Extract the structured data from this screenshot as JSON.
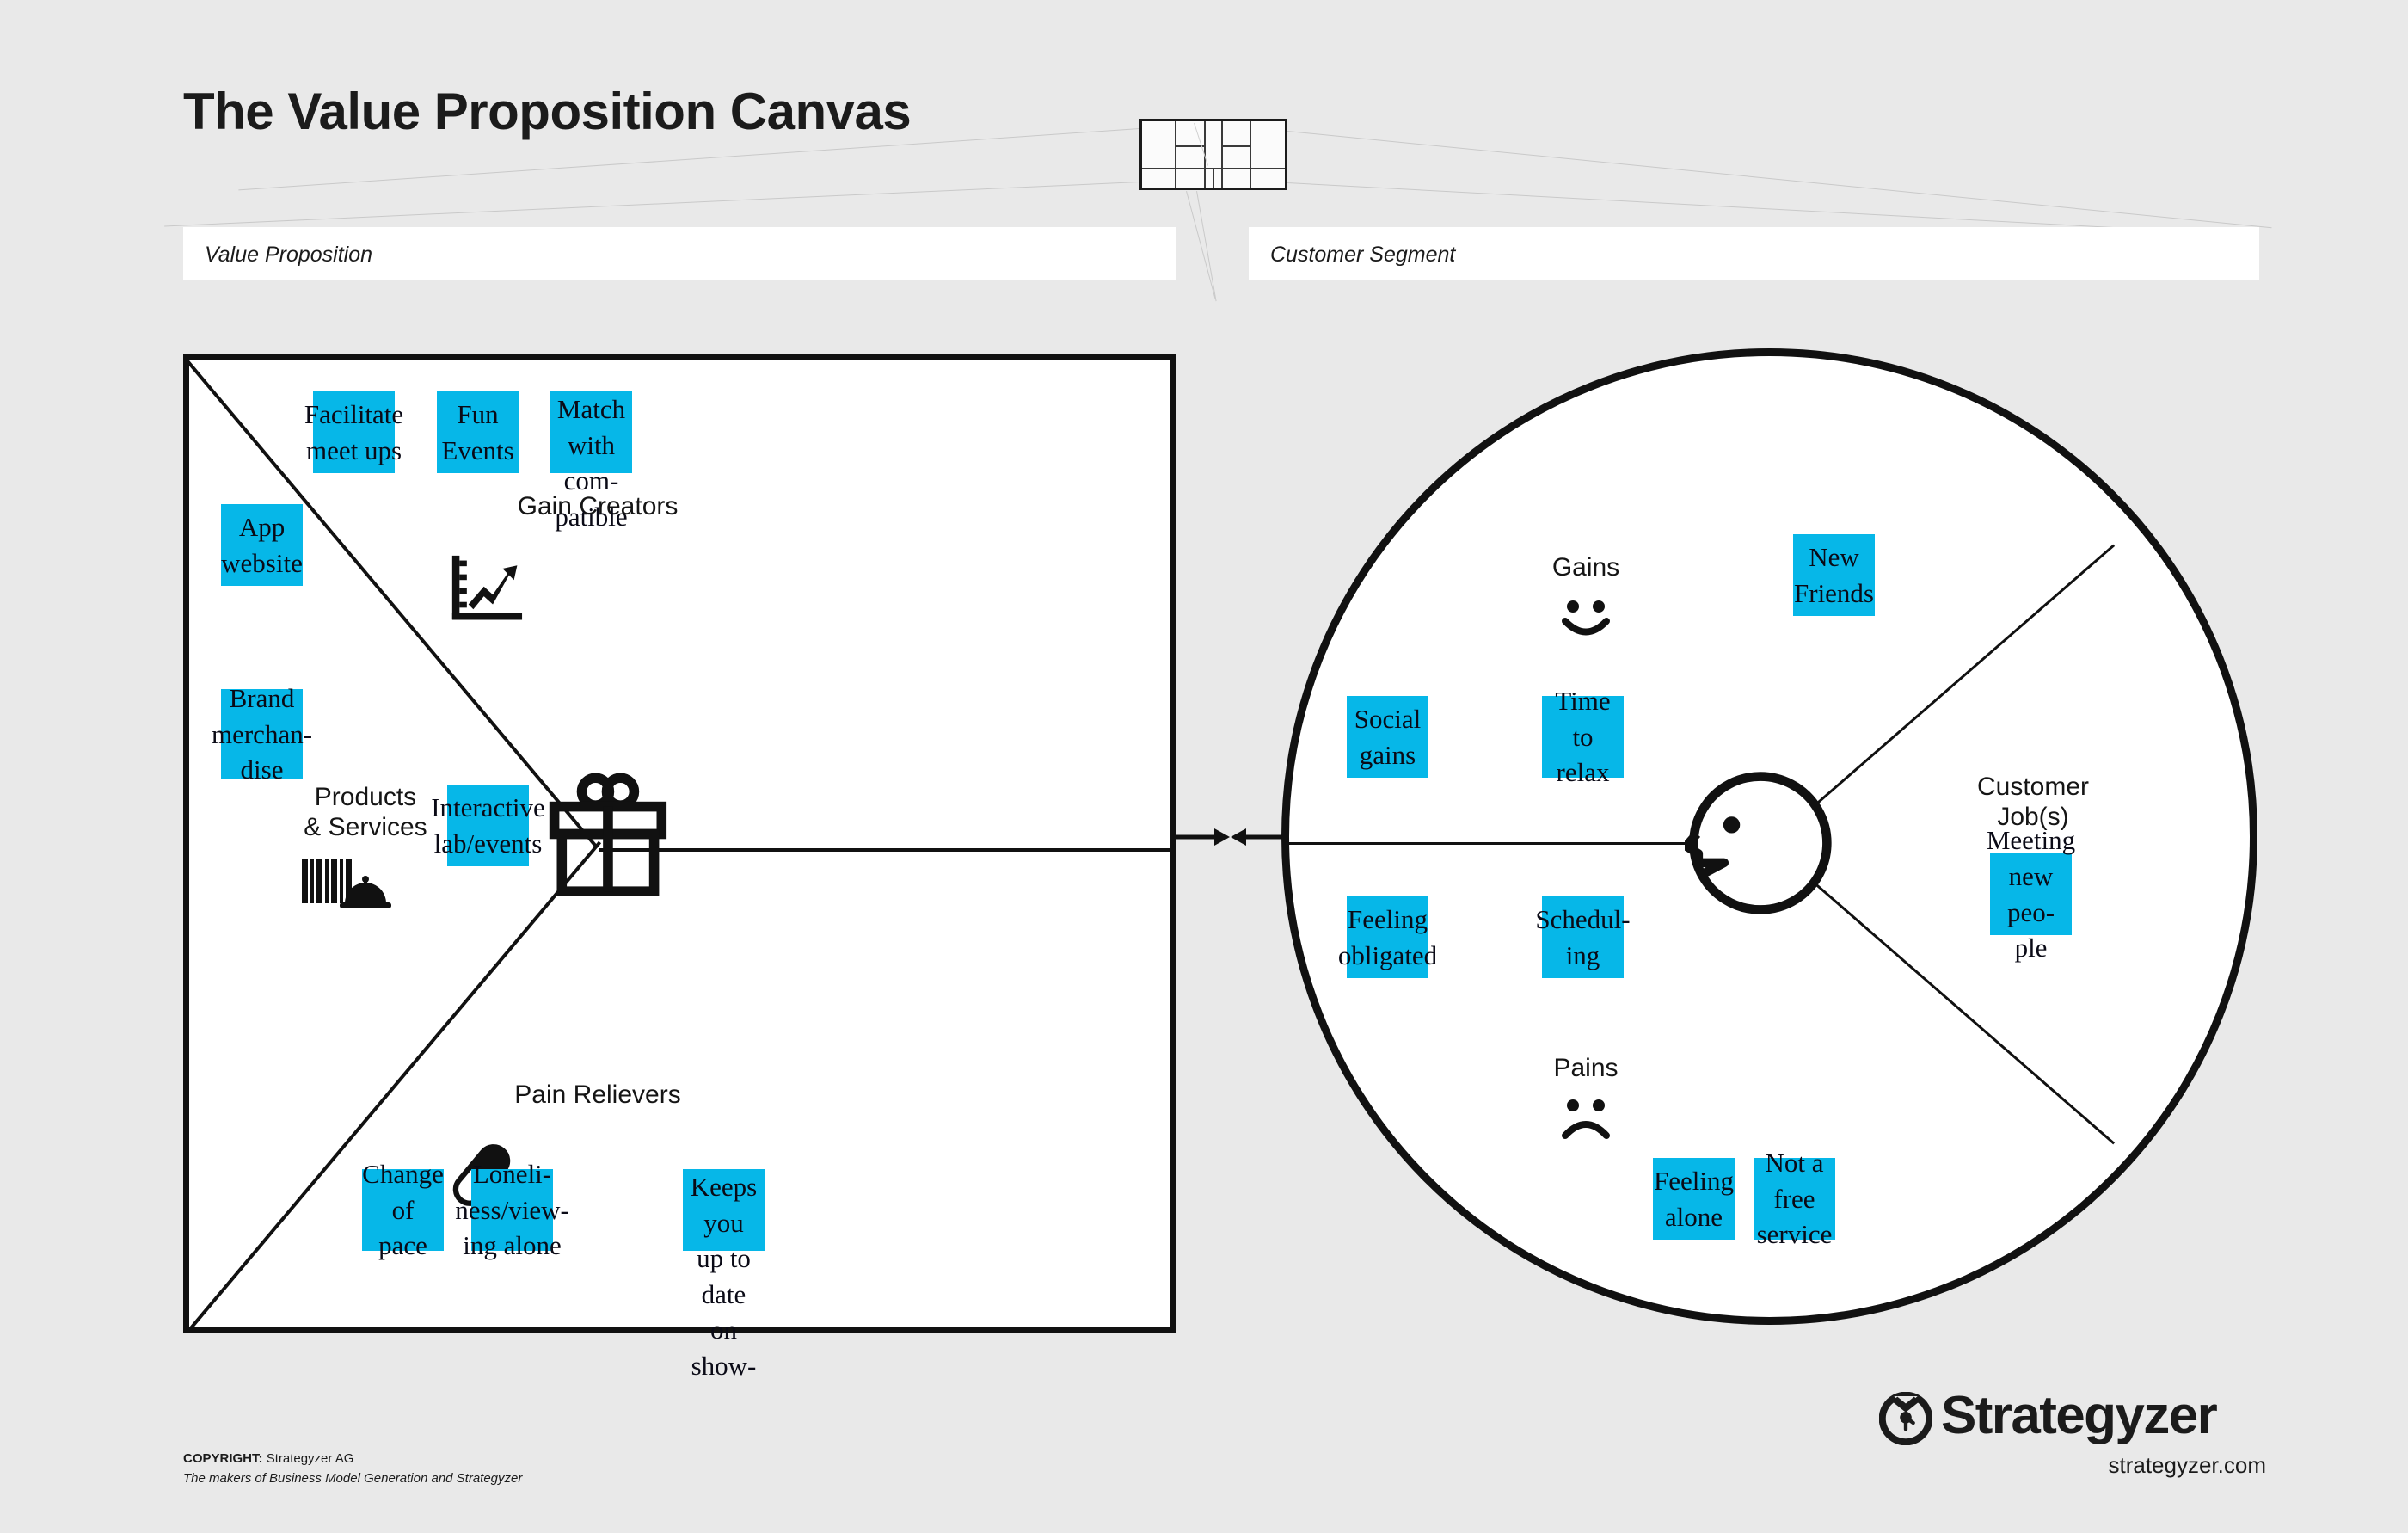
{
  "page": {
    "title": "The Value Proposition Canvas",
    "background_color": "#e9e9e9",
    "note_color": "#06b7e8",
    "ink_color": "#111111"
  },
  "headers": {
    "value_proposition": "Value Proposition",
    "customer_segment": "Customer Segment"
  },
  "thumbnail": {
    "name": "business-model-canvas-thumbnail"
  },
  "value_proposition": {
    "sections": [
      {
        "key": "gain_creators",
        "label": "Gain Creators",
        "icon": "growth-chart-icon"
      },
      {
        "key": "products_services",
        "label": "Products\n& Services",
        "icon": "barcode-and-service-dome-icon"
      },
      {
        "key": "pain_relievers",
        "label": "Pain Relievers",
        "icon": "pill-capsule-icon"
      }
    ],
    "center_icon": "gift-box-icon",
    "notes": [
      {
        "id": "vp-note-1",
        "section": "gain_creators",
        "text": "Facilitate\nmeet ups"
      },
      {
        "id": "vp-note-2",
        "section": "gain_creators",
        "text": "Fun\nEvents"
      },
      {
        "id": "vp-note-3",
        "section": "gain_creators",
        "text": "Match\nwith com-\npatible"
      },
      {
        "id": "vp-note-4",
        "section": "products_services",
        "text": "App\nwebsite"
      },
      {
        "id": "vp-note-5",
        "section": "products_services",
        "text": "Interactive\nlab/events"
      },
      {
        "id": "vp-note-6",
        "section": "products_services",
        "text": "Brand\nmerchan-\ndise"
      },
      {
        "id": "vp-note-7",
        "section": "pain_relievers",
        "text": "Change of\npace"
      },
      {
        "id": "vp-note-8",
        "section": "pain_relievers",
        "text": "Loneli-\nness/view-\ning alone"
      },
      {
        "id": "vp-note-9",
        "section": "pain_relievers",
        "text": "Keeps you\nup to date\non show-"
      }
    ]
  },
  "customer_segment": {
    "sections": [
      {
        "key": "gains",
        "label": "Gains",
        "icon": "smiley-face-icon"
      },
      {
        "key": "pains",
        "label": "Pains",
        "icon": "frowny-face-icon"
      },
      {
        "key": "customer_jobs",
        "label": "Customer\nJob(s)",
        "icon": null
      }
    ],
    "center_icon": "customer-head-profile-icon",
    "notes": [
      {
        "id": "cs-note-1",
        "section": "gains",
        "text": "New\nFriends"
      },
      {
        "id": "cs-note-2",
        "section": "gains",
        "text": "Social\ngains"
      },
      {
        "id": "cs-note-3",
        "section": "gains",
        "text": "Time to\nrelax"
      },
      {
        "id": "cs-note-4",
        "section": "pains",
        "text": "Feeling\nobligated"
      },
      {
        "id": "cs-note-5",
        "section": "pains",
        "text": "Schedul-\ning"
      },
      {
        "id": "cs-note-6",
        "section": "pains",
        "text": "Feeling\nalone"
      },
      {
        "id": "cs-note-7",
        "section": "pains",
        "text": "Not a free\nservice"
      },
      {
        "id": "cs-note-8",
        "section": "customer_jobs",
        "text": "Meeting\nnew peo-\nple"
      }
    ]
  },
  "fit_indicator": {
    "name": "fit-arrows",
    "description": "two arrows pointing toward each other"
  },
  "footer": {
    "copyright_label": "COPYRIGHT:",
    "copyright_holder": "Strategyzer AG",
    "tagline": "The makers of Business Model Generation and Strategyzer",
    "brand_name": "Strategyzer",
    "brand_url": "strategyzer.com"
  }
}
